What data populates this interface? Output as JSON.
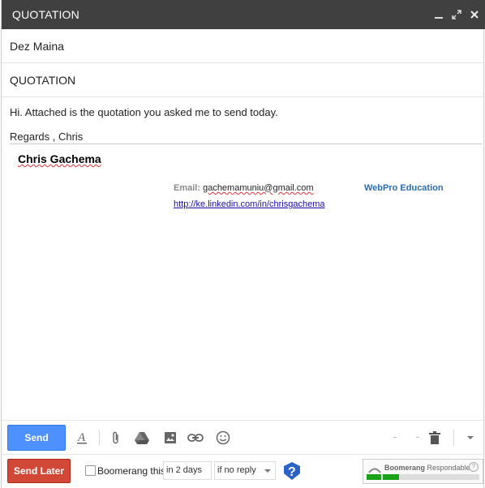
{
  "window": {
    "title": "QUOTATION",
    "controls": [
      "minimize-icon",
      "expand-icon",
      "close-icon"
    ]
  },
  "compose": {
    "to": "Dez Maina",
    "subject": "QUOTATION",
    "body_line1": "Hi.  Attached is the quotation you asked me to send today.",
    "body_line2": "Regards , Chris"
  },
  "signature": {
    "name": "Chris Gachema",
    "email_label": "Email:",
    "email_value": "gachemamuniu@gmail.com",
    "company": "WebPro Education",
    "link": "http://ke.linkedin.com/in/chrisgachema"
  },
  "toolbar": {
    "send_label": "Send",
    "icons": [
      "text-format-icon",
      "attach-icon",
      "drive-icon",
      "photo-icon",
      "link-icon",
      "emoji-icon",
      "trash-icon",
      "more-options-icon"
    ]
  },
  "boomerang": {
    "send_later_label": "Send Later",
    "boomerang_this_label": "Boomerang this",
    "delay_value": "in 2 days",
    "condition_value": "if no reply",
    "respondable_brand": "Boomerang",
    "respondable_label": "Respondable",
    "respondable_help": "?",
    "respondable_score": 0.3
  },
  "colors": {
    "titlebar": "#404040",
    "send_button": "#4d90fe",
    "send_later_button": "#d14836",
    "link": "#1a0dab",
    "company": "#2a6cb0",
    "respondable_good": "#1aa21a"
  }
}
